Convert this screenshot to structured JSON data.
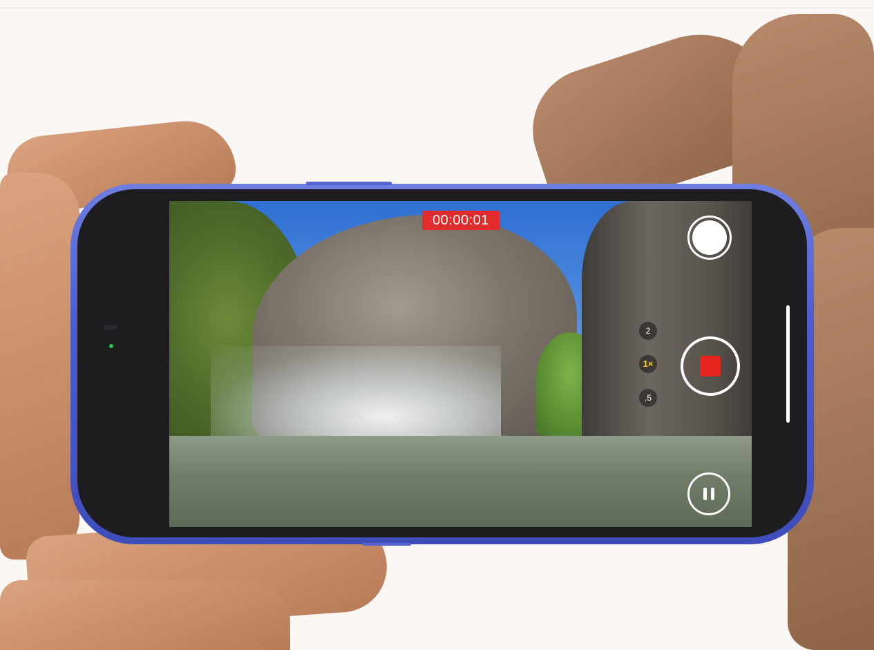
{
  "camera": {
    "recording_timer": "00:00:01",
    "zoom_levels": [
      {
        "label": "2",
        "active": false
      },
      {
        "label": "1×",
        "active": true
      },
      {
        "label": ".5",
        "active": false
      }
    ],
    "icons": {
      "photo_shutter": "shutter-icon",
      "record": "stop-record-icon",
      "pause": "pause-icon"
    }
  },
  "colors": {
    "phone_body": "#4b5bd0",
    "timer_badge": "#e22b2b",
    "record_stop": "#e5261f",
    "active_zoom": "#ffd60a",
    "mic_indicator": "#22c84a"
  }
}
